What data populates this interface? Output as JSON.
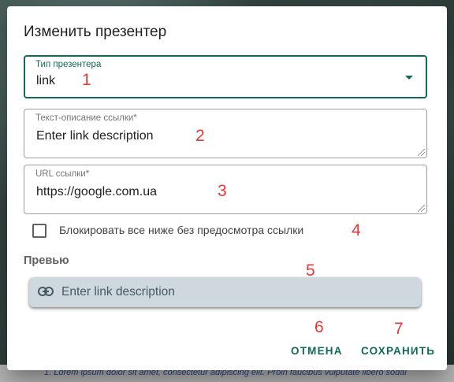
{
  "background": {
    "text": "1. Lorem ipsum dolor sit amet, consectetur adipiscing elit. Proin faucibus vulputate libero sodal"
  },
  "dialog": {
    "title": "Изменить презентер",
    "presenter_type": {
      "label": "Тип презентера",
      "value": "link",
      "icon": "dropdown-arrow-icon"
    },
    "link_text": {
      "label": "Текст-описание ссылки*",
      "value": "Enter link description"
    },
    "link_url": {
      "label": "URL ссылки*",
      "value": "https://google.com.ua"
    },
    "block_checkbox": {
      "label": "Блокировать все ниже без предосмотра ссылки",
      "checked": false
    },
    "preview": {
      "section_label": "Превью",
      "chip_text": "Enter link description",
      "icon": "link-icon"
    },
    "actions": {
      "cancel": "ОТМЕНА",
      "save": "СОХРАНИТЬ"
    }
  },
  "annotations": [
    "1",
    "2",
    "3",
    "4",
    "5",
    "6",
    "7"
  ],
  "colors": {
    "accent": "#12695a",
    "marker": "#e53935",
    "chip_bg": "#cfd8dc"
  }
}
